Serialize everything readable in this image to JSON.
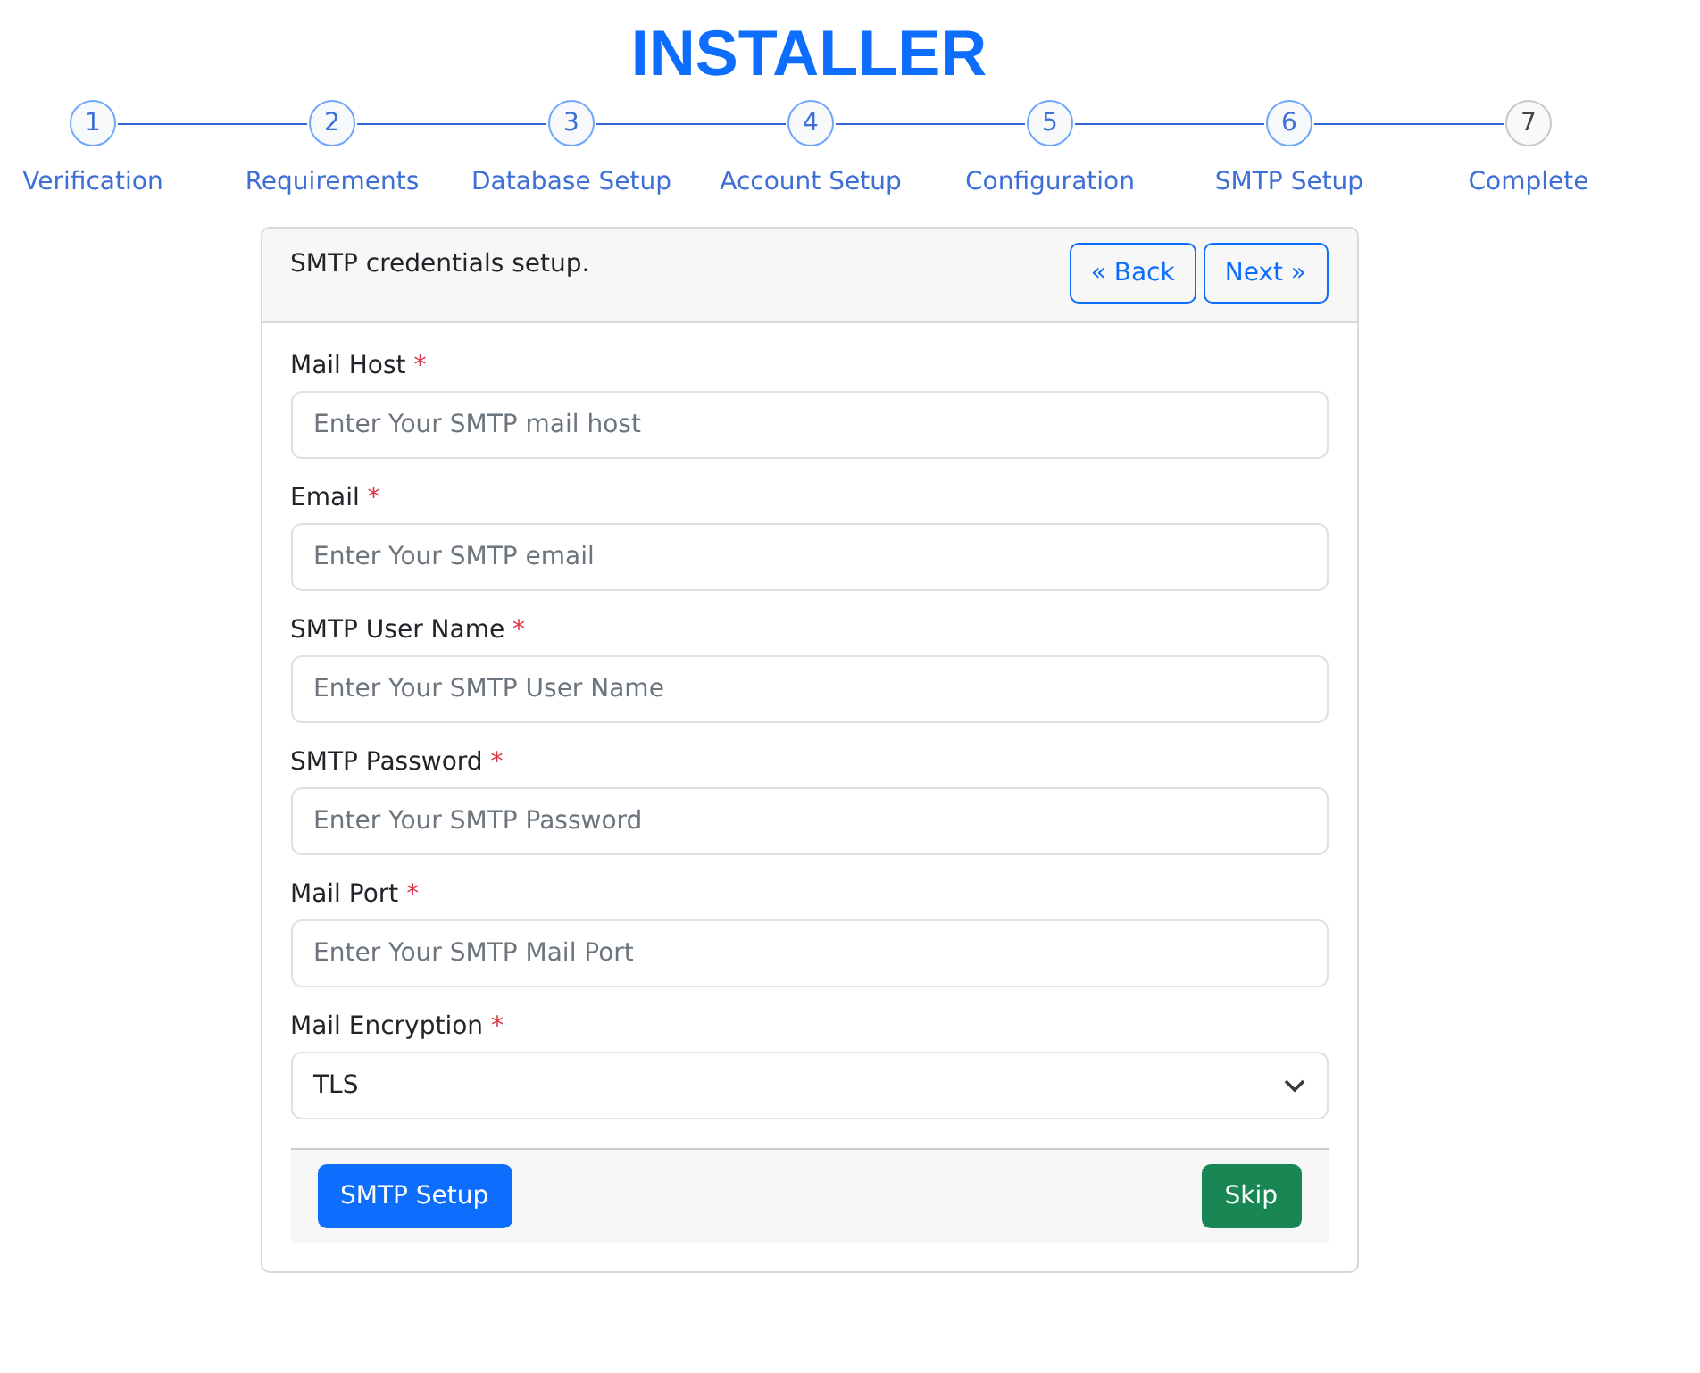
{
  "title": "INSTALLER",
  "steps": [
    {
      "number": "1",
      "label": "Verification",
      "done": true
    },
    {
      "number": "2",
      "label": "Requirements",
      "done": true
    },
    {
      "number": "3",
      "label": "Database Setup",
      "done": true
    },
    {
      "number": "4",
      "label": "Account Setup",
      "done": true
    },
    {
      "number": "5",
      "label": "Configuration",
      "done": true
    },
    {
      "number": "6",
      "label": "SMTP Setup",
      "done": true
    },
    {
      "number": "7",
      "label": "Complete",
      "done": false
    }
  ],
  "card": {
    "heading": "SMTP credentials setup.",
    "back_button": "« Back",
    "next_button": "Next »",
    "fields": [
      {
        "kind": "input",
        "label": "Mail Host",
        "required": "*",
        "placeholder": "Enter Your SMTP mail host"
      },
      {
        "kind": "input",
        "label": "Email",
        "required": "*",
        "placeholder": "Enter Your SMTP email"
      },
      {
        "kind": "input",
        "label": "SMTP User Name",
        "required": "*",
        "placeholder": "Enter Your SMTP User Name"
      },
      {
        "kind": "input",
        "label": "SMTP Password",
        "required": "*",
        "placeholder": "Enter Your SMTP Password"
      },
      {
        "kind": "input",
        "label": "Mail Port",
        "required": "*",
        "placeholder": "Enter Your SMTP Mail Port"
      },
      {
        "kind": "select",
        "label": "Mail Encryption",
        "required": "*",
        "value": "TLS"
      }
    ],
    "submit_button": "SMTP Setup",
    "skip_button": "Skip"
  }
}
